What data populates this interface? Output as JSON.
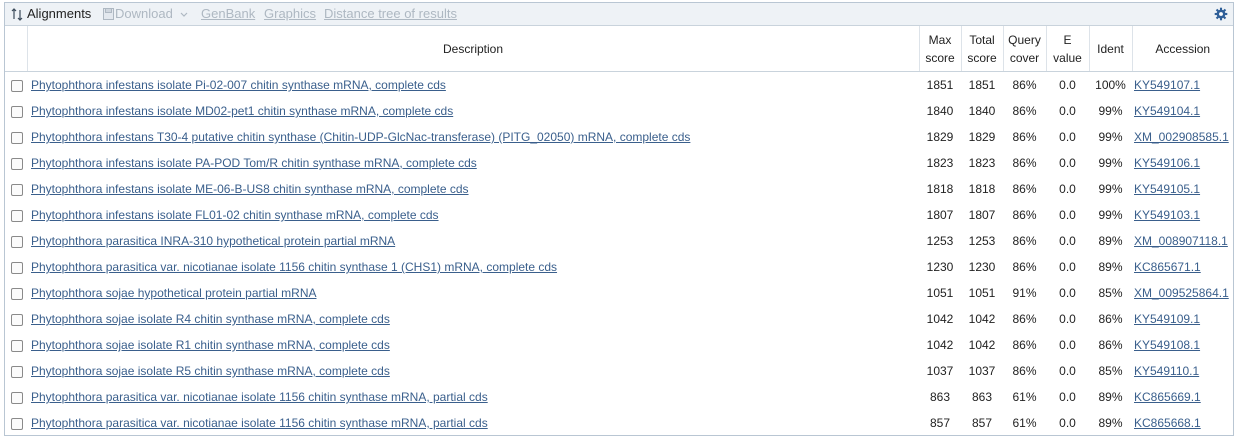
{
  "toolbar": {
    "alignments_label": "Alignments",
    "download_label": "Download",
    "genbank_label": "GenBank",
    "graphics_label": "Graphics",
    "tree_label": "Distance tree of results",
    "settings_icon": "gear-icon"
  },
  "columns": {
    "description": "Description",
    "max_score": [
      "Max",
      "score"
    ],
    "total_score": [
      "Total",
      "score"
    ],
    "query_cover": [
      "Query",
      "cover"
    ],
    "e_value": [
      "E",
      "value"
    ],
    "ident": "Ident",
    "accession": "Accession"
  },
  "rows": [
    {
      "description": "Phytophthora infestans isolate Pi-02-007 chitin synthase mRNA, complete cds",
      "max_score": "1851",
      "total_score": "1851",
      "query_cover": "86%",
      "e_value": "0.0",
      "ident": "100%",
      "accession": "KY549107.1"
    },
    {
      "description": "Phytophthora infestans isolate MD02-pet1 chitin synthase mRNA, complete cds",
      "max_score": "1840",
      "total_score": "1840",
      "query_cover": "86%",
      "e_value": "0.0",
      "ident": "99%",
      "accession": "KY549104.1"
    },
    {
      "description": "Phytophthora infestans T30-4 putative chitin synthase (Chitin-UDP-GlcNac-transferase) (PITG_02050) mRNA, complete cds",
      "max_score": "1829",
      "total_score": "1829",
      "query_cover": "86%",
      "e_value": "0.0",
      "ident": "99%",
      "accession": "XM_002908585.1"
    },
    {
      "description": "Phytophthora infestans isolate PA-POD Tom/R chitin synthase mRNA, complete cds",
      "max_score": "1823",
      "total_score": "1823",
      "query_cover": "86%",
      "e_value": "0.0",
      "ident": "99%",
      "accession": "KY549106.1"
    },
    {
      "description": "Phytophthora infestans isolate ME-06-B-US8 chitin synthase mRNA, complete cds",
      "max_score": "1818",
      "total_score": "1818",
      "query_cover": "86%",
      "e_value": "0.0",
      "ident": "99%",
      "accession": "KY549105.1"
    },
    {
      "description": "Phytophthora infestans isolate FL01-02 chitin synthase mRNA, complete cds",
      "max_score": "1807",
      "total_score": "1807",
      "query_cover": "86%",
      "e_value": "0.0",
      "ident": "99%",
      "accession": "KY549103.1"
    },
    {
      "description": "Phytophthora parasitica INRA-310 hypothetical protein partial mRNA",
      "max_score": "1253",
      "total_score": "1253",
      "query_cover": "86%",
      "e_value": "0.0",
      "ident": "89%",
      "accession": "XM_008907118.1"
    },
    {
      "description": "Phytophthora parasitica var. nicotianae isolate 1156 chitin synthase 1 (CHS1) mRNA, complete cds",
      "max_score": "1230",
      "total_score": "1230",
      "query_cover": "86%",
      "e_value": "0.0",
      "ident": "89%",
      "accession": "KC865671.1"
    },
    {
      "description": "Phytophthora sojae hypothetical protein partial mRNA",
      "max_score": "1051",
      "total_score": "1051",
      "query_cover": "91%",
      "e_value": "0.0",
      "ident": "85%",
      "accession": "XM_009525864.1"
    },
    {
      "description": "Phytophthora sojae isolate R4 chitin synthase mRNA, complete cds",
      "max_score": "1042",
      "total_score": "1042",
      "query_cover": "86%",
      "e_value": "0.0",
      "ident": "86%",
      "accession": "KY549109.1"
    },
    {
      "description": "Phytophthora sojae isolate R1 chitin synthase mRNA, complete cds",
      "max_score": "1042",
      "total_score": "1042",
      "query_cover": "86%",
      "e_value": "0.0",
      "ident": "86%",
      "accession": "KY549108.1"
    },
    {
      "description": "Phytophthora sojae isolate R5 chitin synthase mRNA, complete cds",
      "max_score": "1037",
      "total_score": "1037",
      "query_cover": "86%",
      "e_value": "0.0",
      "ident": "85%",
      "accession": "KY549110.1"
    },
    {
      "description": "Phytophthora parasitica var. nicotianae isolate 1156 chitin synthase mRNA, partial cds",
      "max_score": "863",
      "total_score": "863",
      "query_cover": "61%",
      "e_value": "0.0",
      "ident": "89%",
      "accession": "KC865669.1"
    },
    {
      "description": "Phytophthora parasitica var. nicotianae isolate 1156 chitin synthase mRNA, partial cds",
      "max_score": "857",
      "total_score": "857",
      "query_cover": "61%",
      "e_value": "0.0",
      "ident": "89%",
      "accession": "KC865668.1"
    }
  ]
}
